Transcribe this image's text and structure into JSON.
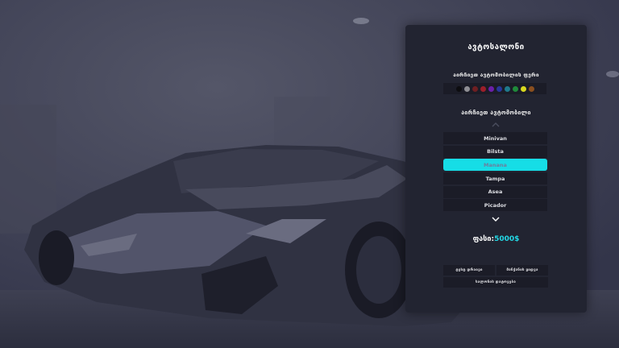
{
  "panel": {
    "title": "ავტოსალონი",
    "colors_label": "აირჩიეთ ავტომობილის ფერი",
    "models_label": "აირჩიეთ ავტომობილი",
    "colors": [
      {
        "name": "black",
        "hex": "#0d0d10"
      },
      {
        "name": "silver",
        "hex": "#8e8e94"
      },
      {
        "name": "dark-red",
        "hex": "#6e1f22"
      },
      {
        "name": "red",
        "hex": "#9c1f2a"
      },
      {
        "name": "purple",
        "hex": "#6b1fa8"
      },
      {
        "name": "blue",
        "hex": "#27379a"
      },
      {
        "name": "teal",
        "hex": "#1f7a8c"
      },
      {
        "name": "green",
        "hex": "#1f8a3a"
      },
      {
        "name": "yellow",
        "hex": "#d8d81f"
      },
      {
        "name": "orange-brown",
        "hex": "#8a4f1f"
      }
    ],
    "models": [
      {
        "label": "Minivan",
        "selected": false
      },
      {
        "label": "Bilsta",
        "selected": false
      },
      {
        "label": "Manana",
        "selected": true
      },
      {
        "label": "Tampa",
        "selected": false
      },
      {
        "label": "Asea",
        "selected": false
      },
      {
        "label": "Picador",
        "selected": false
      }
    ],
    "price_label": "ფასი:",
    "price_value": "5000$",
    "buttons": {
      "test_drive": "ტესტ დრაივი",
      "buy": "მანქანის ყიდვა",
      "exit": "სალონის დატოვება"
    },
    "accent": "#16dde6"
  }
}
